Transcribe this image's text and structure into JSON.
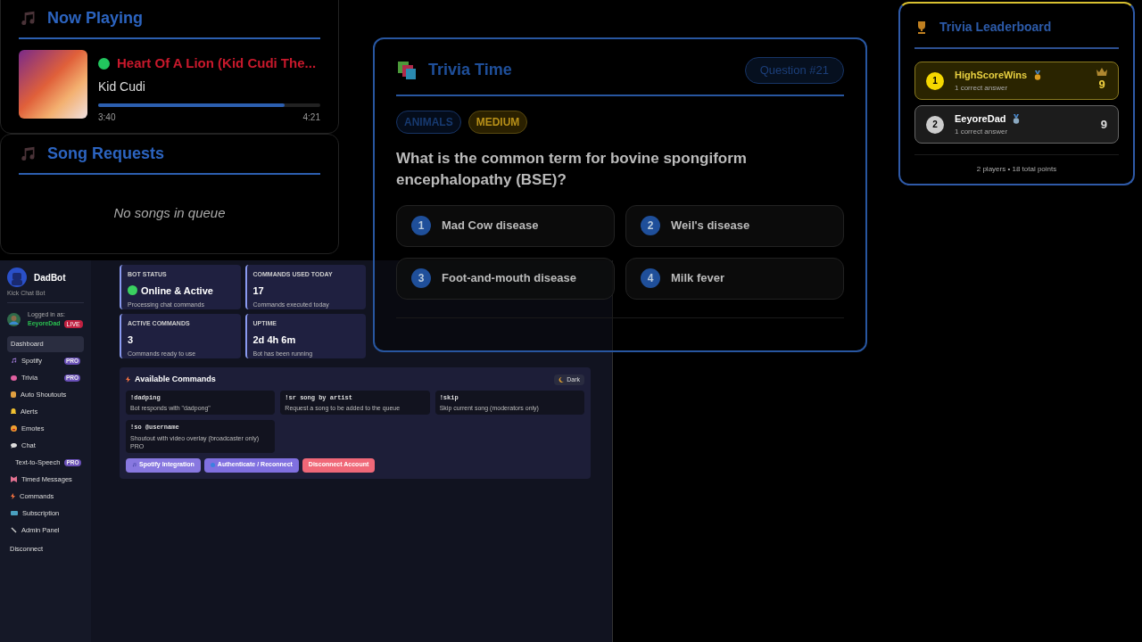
{
  "now_playing": {
    "title": "Now Playing",
    "playing": true,
    "track": "Heart Of A Lion (Kid Cudi The...",
    "artist": "Kid Cudi",
    "level": 0.84,
    "elapsed": "3:40",
    "duration": "4:21"
  },
  "song_requests": {
    "title": "Song Requests",
    "empty_text": "No songs in queue"
  },
  "trivia": {
    "title": "Trivia Time",
    "question_number": "Question #21",
    "tags": [
      {
        "kind": "category",
        "label": "ANIMALS"
      },
      {
        "kind": "difficulty",
        "label": "MEDIUM"
      }
    ],
    "question": "What is the common term for bovine spongiform encephalopathy (BSE)?",
    "answers": [
      {
        "number": "1",
        "text": "Mad Cow disease"
      },
      {
        "number": "2",
        "text": "Weil's disease"
      },
      {
        "number": "3",
        "text": "Foot-and-mouth disease"
      },
      {
        "number": "4",
        "text": "Milk fever"
      }
    ]
  },
  "leaderboard": {
    "title": "Trivia Leaderboard",
    "players": [
      {
        "rank": "1",
        "name": "HighScoreWins",
        "detail": "1 correct answer",
        "score": "9",
        "leader": true,
        "color": "#d89a20"
      },
      {
        "rank": "2",
        "name": "EeyoreDad",
        "detail": "1 correct answer",
        "score": "9",
        "leader": false,
        "color": "#8aa8c0"
      }
    ],
    "footer": "2 players • 18 total points"
  },
  "dashboard": {
    "bot_name": "DadBot",
    "bot_subtitle": "Kick Chat Bot",
    "logged_in_label": "Logged in as:",
    "user": "EeyoreDad",
    "live_badge": "LIVE",
    "sidebar": {
      "items": [
        {
          "label": "Dashboard",
          "selected": true
        },
        {
          "label": "Spotify",
          "selected": false,
          "badge": "PRO"
        },
        {
          "label": "Trivia",
          "selected": false,
          "badge": "PRO"
        },
        {
          "label": "Auto Shoutouts",
          "selected": false
        },
        {
          "label": "Alerts",
          "selected": false
        },
        {
          "label": "Emotes",
          "selected": false
        },
        {
          "label": "Chat",
          "selected": false
        },
        {
          "label": "Text-to-Speech",
          "selected": false,
          "badge": "PRO"
        },
        {
          "label": "Timed Messages",
          "selected": false
        },
        {
          "label": "Commands",
          "selected": false
        },
        {
          "label": "Subscription",
          "selected": false
        },
        {
          "label": "Admin Panel",
          "selected": false
        }
      ],
      "footer": "Disconnect"
    },
    "theme_toggle": "Dark",
    "stats": [
      {
        "label": "BOT STATUS",
        "value": "Online & Active",
        "note": "Processing chat commands",
        "online": true
      },
      {
        "label": "COMMANDS USED TODAY",
        "value": "17",
        "note": "Commands executed today"
      },
      {
        "label": "ACTIVE COMMANDS",
        "value": "3",
        "note": "Commands ready to use"
      },
      {
        "label": "UPTIME",
        "value": "2d 4h 6m",
        "note": "Bot has been running"
      }
    ],
    "commands_title": "Available Commands",
    "commands": [
      {
        "command": "!dadping",
        "description": "Bot responds with \"dadpong\""
      },
      {
        "command": "!sr song by artist",
        "description": "Request a song to be added to the queue"
      },
      {
        "command": "!skip",
        "description": "Skip current song (moderators only)"
      },
      {
        "command": "!so @username",
        "description": "Shoutout with video overlay (broadcaster only) PRO"
      }
    ],
    "buttons": [
      {
        "kind": "spotify",
        "label": "Spotify Integration"
      },
      {
        "kind": "auth",
        "label": "Authenticate / Reconnect"
      },
      {
        "kind": "danger",
        "label": "Disconnect Account"
      }
    ]
  }
}
